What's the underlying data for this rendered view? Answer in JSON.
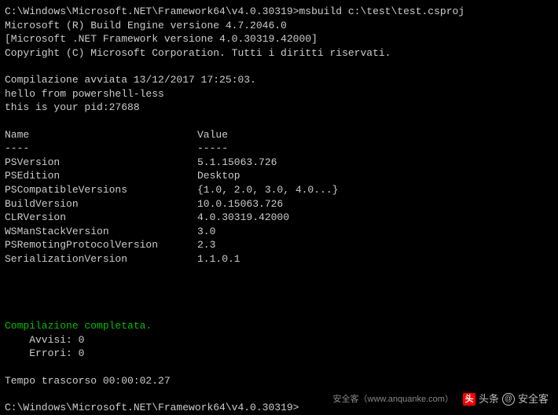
{
  "prompt1": {
    "path": "C:\\Windows\\Microsoft.NET\\Framework64\\v4.0.30319>",
    "command": "msbuild c:\\test\\test.csproj"
  },
  "header": [
    "Microsoft (R) Build Engine versione 4.7.2046.0",
    "[Microsoft .NET Framework versione 4.0.30319.42000]",
    "Copyright (C) Microsoft Corporation. Tutti i diritti riservati."
  ],
  "start": "Compilazione avviata 13/12/2017 17:25:03.",
  "hello": "hello from powershell-less",
  "pid": "this is your pid:27688",
  "tableHeader": {
    "name": "Name",
    "value": "Value"
  },
  "tableDivider": {
    "name": "----",
    "value": "-----"
  },
  "rows": [
    {
      "name": "PSVersion",
      "value": "5.1.15063.726"
    },
    {
      "name": "PSEdition",
      "value": "Desktop"
    },
    {
      "name": "PSCompatibleVersions",
      "value": "{1.0, 2.0, 3.0, 4.0...}"
    },
    {
      "name": "BuildVersion",
      "value": "10.0.15063.726"
    },
    {
      "name": "CLRVersion",
      "value": "4.0.30319.42000"
    },
    {
      "name": "WSManStackVersion",
      "value": "3.0"
    },
    {
      "name": "PSRemotingProtocolVersion",
      "value": "2.3"
    },
    {
      "name": "SerializationVersion",
      "value": "1.1.0.1"
    }
  ],
  "done": "Compilazione completata.",
  "warn": "    Avvisi: 0",
  "err": "    Errori: 0",
  "elapsed": "Tempo trascorso 00:00:02.27",
  "prompt2": "C:\\Windows\\Microsoft.NET\\Framework64\\v4.0.30319>",
  "watermark": {
    "small": "安全客（www.anquanke.com）",
    "t": "头条",
    "name": "安全客"
  }
}
